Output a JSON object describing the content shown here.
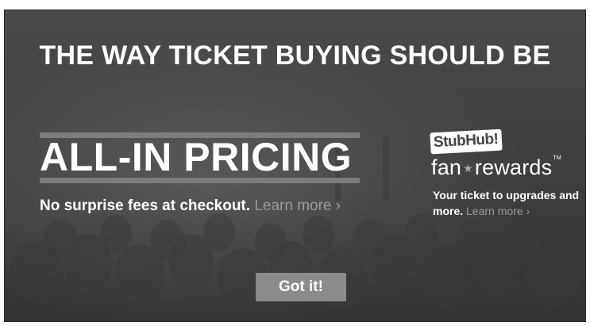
{
  "modal": {
    "headline": "THE WAY TICKET BUYING SHOULD BE",
    "all_in": {
      "title": "ALL-IN PRICING",
      "subtitle": "No surprise fees at checkout.",
      "learn_more": "Learn more ›"
    },
    "fan_rewards": {
      "logo_text": "StubHub!",
      "brand_word_1": "fan",
      "brand_star": "★",
      "brand_word_2": "rewards",
      "brand_tm": "TM",
      "subtitle": "Your ticket to upgrades and more.",
      "learn_more": "Learn more ›"
    },
    "got_it_label": "Got it!"
  },
  "icons": {
    "star": "star-icon",
    "chevron": "chevron-right-icon"
  },
  "colors": {
    "background": "#444444",
    "text": "#ffffff",
    "muted_link": "#9a9a9a",
    "button": "#8b8b8b"
  }
}
